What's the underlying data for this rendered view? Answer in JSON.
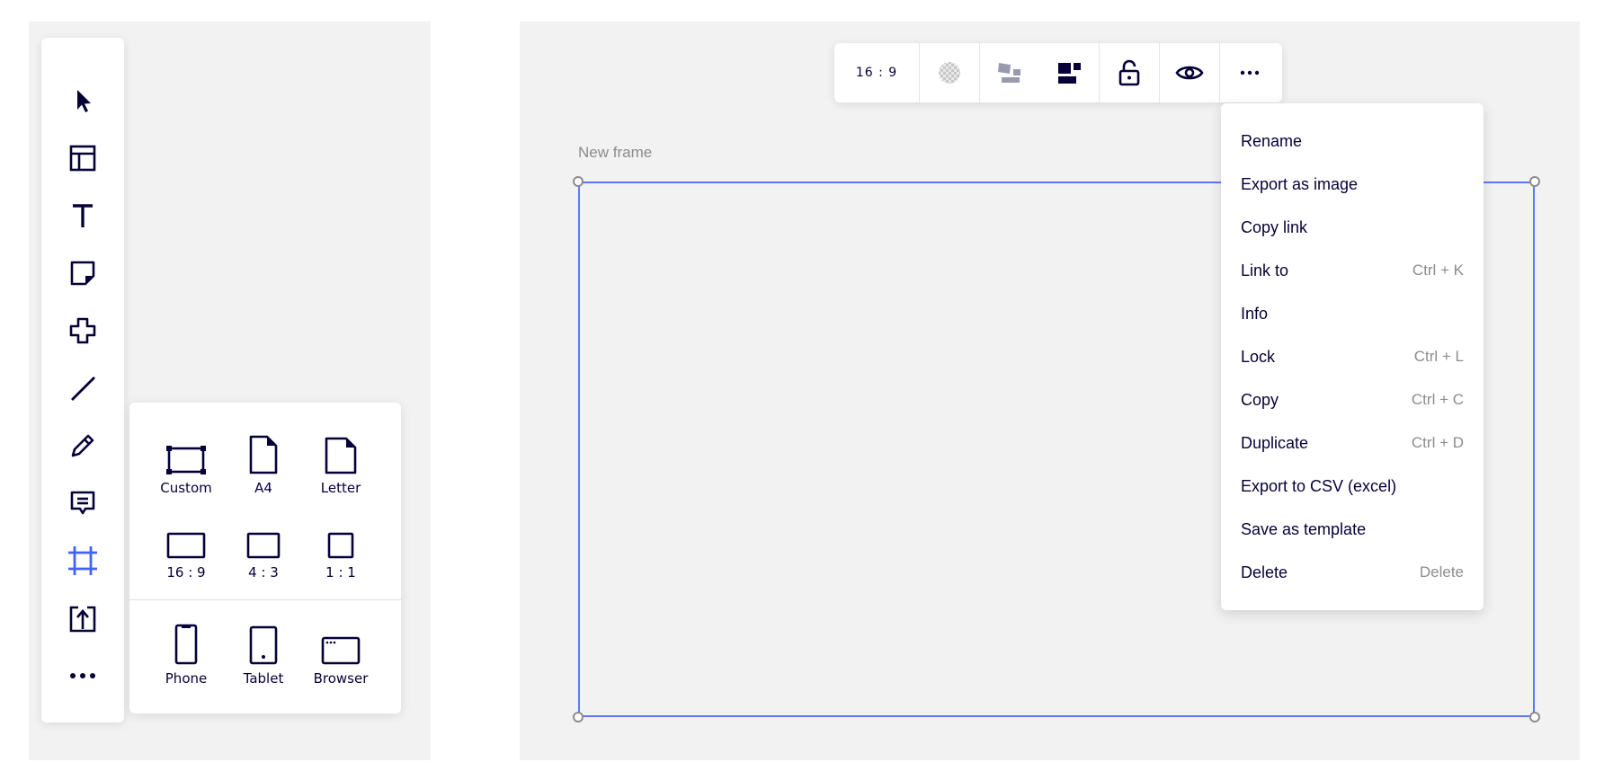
{
  "colors": {
    "accent": "#4262ff",
    "ink": "#050038",
    "muted": "#8c8c8c",
    "canvas": "#f2f2f2"
  },
  "toolbar": {
    "tools": [
      {
        "name": "select-tool",
        "icon": "cursor-icon"
      },
      {
        "name": "templates-tool",
        "icon": "layout-icon"
      },
      {
        "name": "text-tool",
        "icon": "text-icon"
      },
      {
        "name": "sticky-note-tool",
        "icon": "sticky-note-icon"
      },
      {
        "name": "shapes-tool",
        "icon": "shape-icon"
      },
      {
        "name": "line-tool",
        "icon": "line-icon"
      },
      {
        "name": "pen-tool",
        "icon": "pen-icon"
      },
      {
        "name": "comment-tool",
        "icon": "comment-icon"
      },
      {
        "name": "frame-tool",
        "icon": "frame-icon",
        "active": true
      },
      {
        "name": "upload-tool",
        "icon": "upload-icon"
      },
      {
        "name": "more-tools",
        "icon": "more-icon"
      }
    ]
  },
  "frame_presets": {
    "items": [
      {
        "label": "Custom"
      },
      {
        "label": "A4"
      },
      {
        "label": "Letter"
      },
      {
        "label": "16 : 9"
      },
      {
        "label": "4 : 3"
      },
      {
        "label": "1 : 1"
      },
      {
        "label": "Phone"
      },
      {
        "label": "Tablet"
      },
      {
        "label": "Browser"
      }
    ]
  },
  "context_toolbar": {
    "ratio": "16 : 9",
    "icons": [
      "transparency-icon",
      "arrange-icon",
      "grid-icon",
      "unlock-icon",
      "eye-icon",
      "more-horizontal-icon"
    ]
  },
  "frame": {
    "title": "New frame"
  },
  "context_menu": {
    "items": [
      {
        "label": "Rename",
        "shortcut": ""
      },
      {
        "label": "Export as image",
        "shortcut": ""
      },
      {
        "label": "Copy link",
        "shortcut": ""
      },
      {
        "label": "Link to",
        "shortcut": "Ctrl + K"
      },
      {
        "label": "Info",
        "shortcut": ""
      },
      {
        "label": "Lock",
        "shortcut": "Ctrl + L"
      },
      {
        "label": "Copy",
        "shortcut": "Ctrl + C"
      },
      {
        "label": "Duplicate",
        "shortcut": "Ctrl + D"
      },
      {
        "label": "Export to CSV (excel)",
        "shortcut": ""
      },
      {
        "label": "Save as template",
        "shortcut": ""
      },
      {
        "label": "Delete",
        "shortcut": "Delete"
      }
    ]
  }
}
